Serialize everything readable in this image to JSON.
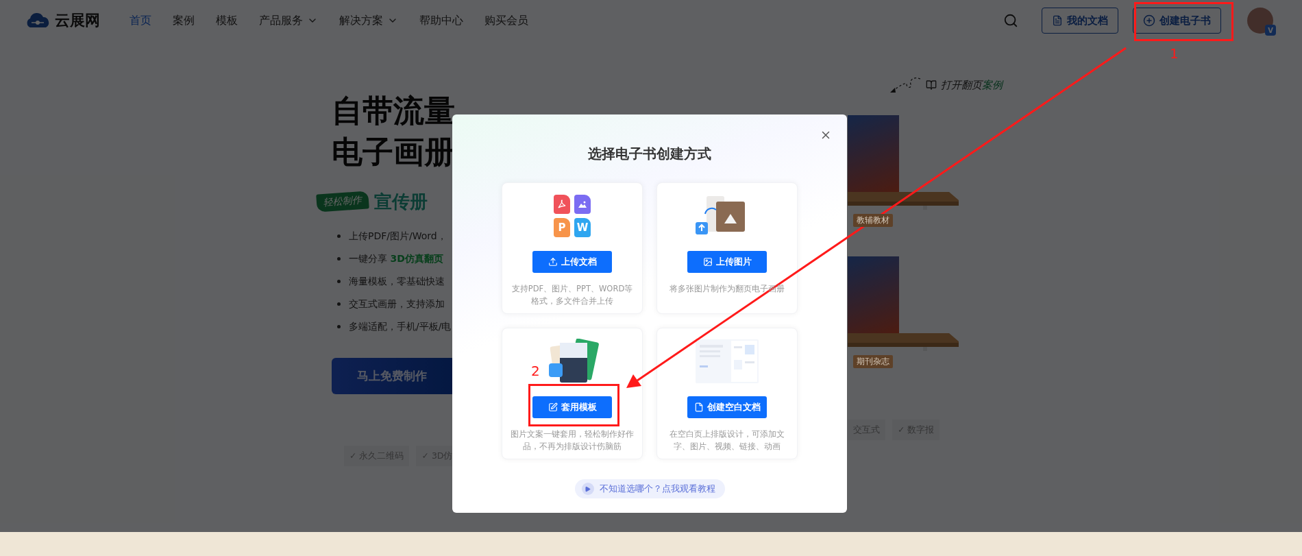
{
  "nav": {
    "logo": "云展网",
    "items": [
      {
        "label": "首页",
        "selected": true,
        "dropdown": false
      },
      {
        "label": "案例",
        "selected": false,
        "dropdown": false
      },
      {
        "label": "模板",
        "selected": false,
        "dropdown": false
      },
      {
        "label": "产品服务",
        "selected": false,
        "dropdown": true
      },
      {
        "label": "解决方案",
        "selected": false,
        "dropdown": true
      },
      {
        "label": "帮助中心",
        "selected": false,
        "dropdown": false
      },
      {
        "label": "购买会员",
        "selected": false,
        "dropdown": false
      }
    ],
    "actions": [
      {
        "label": "我的文档",
        "kind": "document"
      },
      {
        "label": "创建电子书",
        "kind": "create"
      }
    ],
    "avatar_badge": "V"
  },
  "hero": {
    "headline": [
      "自带流量",
      "电子画册"
    ],
    "badge": "轻松制作",
    "subtitle": "宣传册",
    "bullets": [
      "上传PDF/图片/Word，",
      "一键分享 **3D仿真翻页**",
      "海量模板，零基础快速",
      "交互式画册，支持添加",
      "多端适配，手机/平板/电"
    ],
    "cta": "马上免费制作",
    "features": [
      "✓ 永久二维码",
      "✓ 3D仿"
    ]
  },
  "showcase": {
    "hint": "打开翻页**案例**",
    "shelves": [
      {
        "label": "教辅教材"
      },
      {
        "label": "期刊杂志"
      }
    ],
    "features": [
      "交互式",
      "✓ 数字报"
    ]
  },
  "modal": {
    "title": "选择电子书创建方式",
    "options": [
      {
        "kind": "upload_doc",
        "button": "上传文档",
        "description": "支持PDF、图片、PPT、WORD等格式，多文件合并上传",
        "file_letters": [
          "P",
          "W"
        ]
      },
      {
        "kind": "upload_image",
        "button": "上传图片",
        "description": "将多张图片制作为翻页电子画册"
      },
      {
        "kind": "template",
        "button": "套用模板",
        "description": "图片文案一键套用，轻松制作好作品，不再为排版设计伤脑筋"
      },
      {
        "kind": "blank",
        "button": "创建空白文档",
        "description": "在空白页上排版设计，可添加文字、图片、视频、链接、动画"
      }
    ],
    "help": "不知道选哪个？点我观看教程"
  },
  "annotations": [
    {
      "label": "1"
    },
    {
      "label": "2"
    }
  ]
}
